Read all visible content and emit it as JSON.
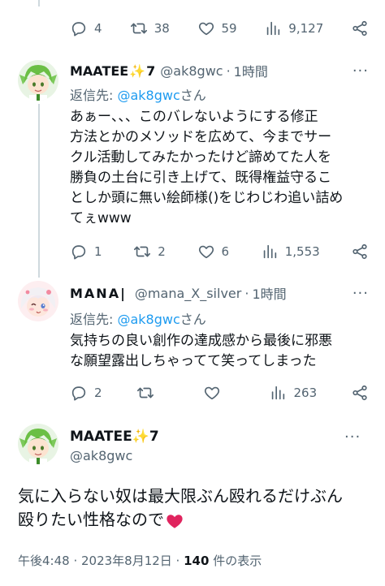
{
  "tweet0": {
    "reply_count": "4",
    "retweet_count": "38",
    "like_count": "59",
    "view_count": "9,127"
  },
  "tweet1": {
    "name": "MAATEE",
    "name_suffix": "7",
    "handle": "@ak8gwc",
    "time": "1時間",
    "reply_prefix": "返信先: ",
    "reply_mention": "@ak8gwc",
    "reply_suffix": "さん",
    "lines": [
      "あぁー、、、このバレないようにする修正",
      "方法とかのメソッドを広めて、今までサー",
      "クル活動してみたかったけど諦めてた人を",
      "勝負の土台に引き上げて、既得権益守るこ",
      "としか頭に無い絵師様()をじわじわ追い詰め",
      "てぇwww"
    ],
    "reply_count": "1",
    "retweet_count": "2",
    "like_count": "6",
    "view_count": "1,553"
  },
  "tweet2": {
    "name": "MANA|",
    "handle": "@mana_X_silver",
    "time": "1時間",
    "reply_prefix": "返信先: ",
    "reply_mention": "@ak8gwc",
    "reply_suffix": "さん",
    "lines": [
      "気持ちの良い創作の達成感から最後に邪悪",
      "な願望露出しちゃってて笑ってしまった"
    ],
    "reply_count": "2",
    "view_count": "263"
  },
  "main_tweet": {
    "name": "MAATEE",
    "name_suffix": "7",
    "handle": "@ak8gwc",
    "lines": [
      "気に入らない奴は最大限ぶん殴れるだけぶん",
      "殴りたい性格なので"
    ],
    "timestamp": "午後4:48 · 2023年8月12日 · ",
    "views_num": "140",
    "views_label": " 件の表示"
  },
  "icons": [
    "reply-icon",
    "retweet-icon",
    "like-icon",
    "views-icon",
    "share-icon",
    "more-icon",
    "sparkles-icon",
    "heart-emoji-icon"
  ],
  "colors": {
    "accent": "#1d9bf0",
    "muted": "#536471",
    "text": "#0f1419",
    "heart": "#e0245e"
  }
}
